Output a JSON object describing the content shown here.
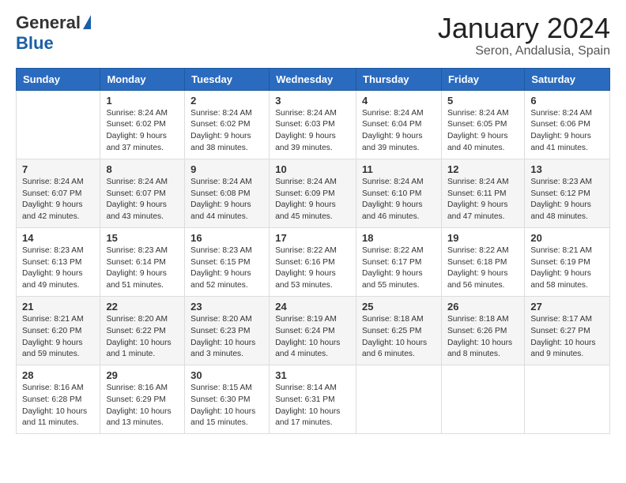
{
  "header": {
    "logo_general": "General",
    "logo_blue": "Blue",
    "title": "January 2024",
    "location": "Seron, Andalusia, Spain"
  },
  "weekdays": [
    "Sunday",
    "Monday",
    "Tuesday",
    "Wednesday",
    "Thursday",
    "Friday",
    "Saturday"
  ],
  "weeks": [
    [
      {
        "day": "",
        "sunrise": "",
        "sunset": "",
        "daylight": ""
      },
      {
        "day": "1",
        "sunrise": "Sunrise: 8:24 AM",
        "sunset": "Sunset: 6:02 PM",
        "daylight": "Daylight: 9 hours and 37 minutes."
      },
      {
        "day": "2",
        "sunrise": "Sunrise: 8:24 AM",
        "sunset": "Sunset: 6:02 PM",
        "daylight": "Daylight: 9 hours and 38 minutes."
      },
      {
        "day": "3",
        "sunrise": "Sunrise: 8:24 AM",
        "sunset": "Sunset: 6:03 PM",
        "daylight": "Daylight: 9 hours and 39 minutes."
      },
      {
        "day": "4",
        "sunrise": "Sunrise: 8:24 AM",
        "sunset": "Sunset: 6:04 PM",
        "daylight": "Daylight: 9 hours and 39 minutes."
      },
      {
        "day": "5",
        "sunrise": "Sunrise: 8:24 AM",
        "sunset": "Sunset: 6:05 PM",
        "daylight": "Daylight: 9 hours and 40 minutes."
      },
      {
        "day": "6",
        "sunrise": "Sunrise: 8:24 AM",
        "sunset": "Sunset: 6:06 PM",
        "daylight": "Daylight: 9 hours and 41 minutes."
      }
    ],
    [
      {
        "day": "7",
        "sunrise": "Sunrise: 8:24 AM",
        "sunset": "Sunset: 6:07 PM",
        "daylight": "Daylight: 9 hours and 42 minutes."
      },
      {
        "day": "8",
        "sunrise": "Sunrise: 8:24 AM",
        "sunset": "Sunset: 6:07 PM",
        "daylight": "Daylight: 9 hours and 43 minutes."
      },
      {
        "day": "9",
        "sunrise": "Sunrise: 8:24 AM",
        "sunset": "Sunset: 6:08 PM",
        "daylight": "Daylight: 9 hours and 44 minutes."
      },
      {
        "day": "10",
        "sunrise": "Sunrise: 8:24 AM",
        "sunset": "Sunset: 6:09 PM",
        "daylight": "Daylight: 9 hours and 45 minutes."
      },
      {
        "day": "11",
        "sunrise": "Sunrise: 8:24 AM",
        "sunset": "Sunset: 6:10 PM",
        "daylight": "Daylight: 9 hours and 46 minutes."
      },
      {
        "day": "12",
        "sunrise": "Sunrise: 8:24 AM",
        "sunset": "Sunset: 6:11 PM",
        "daylight": "Daylight: 9 hours and 47 minutes."
      },
      {
        "day": "13",
        "sunrise": "Sunrise: 8:23 AM",
        "sunset": "Sunset: 6:12 PM",
        "daylight": "Daylight: 9 hours and 48 minutes."
      }
    ],
    [
      {
        "day": "14",
        "sunrise": "Sunrise: 8:23 AM",
        "sunset": "Sunset: 6:13 PM",
        "daylight": "Daylight: 9 hours and 49 minutes."
      },
      {
        "day": "15",
        "sunrise": "Sunrise: 8:23 AM",
        "sunset": "Sunset: 6:14 PM",
        "daylight": "Daylight: 9 hours and 51 minutes."
      },
      {
        "day": "16",
        "sunrise": "Sunrise: 8:23 AM",
        "sunset": "Sunset: 6:15 PM",
        "daylight": "Daylight: 9 hours and 52 minutes."
      },
      {
        "day": "17",
        "sunrise": "Sunrise: 8:22 AM",
        "sunset": "Sunset: 6:16 PM",
        "daylight": "Daylight: 9 hours and 53 minutes."
      },
      {
        "day": "18",
        "sunrise": "Sunrise: 8:22 AM",
        "sunset": "Sunset: 6:17 PM",
        "daylight": "Daylight: 9 hours and 55 minutes."
      },
      {
        "day": "19",
        "sunrise": "Sunrise: 8:22 AM",
        "sunset": "Sunset: 6:18 PM",
        "daylight": "Daylight: 9 hours and 56 minutes."
      },
      {
        "day": "20",
        "sunrise": "Sunrise: 8:21 AM",
        "sunset": "Sunset: 6:19 PM",
        "daylight": "Daylight: 9 hours and 58 minutes."
      }
    ],
    [
      {
        "day": "21",
        "sunrise": "Sunrise: 8:21 AM",
        "sunset": "Sunset: 6:20 PM",
        "daylight": "Daylight: 9 hours and 59 minutes."
      },
      {
        "day": "22",
        "sunrise": "Sunrise: 8:20 AM",
        "sunset": "Sunset: 6:22 PM",
        "daylight": "Daylight: 10 hours and 1 minute."
      },
      {
        "day": "23",
        "sunrise": "Sunrise: 8:20 AM",
        "sunset": "Sunset: 6:23 PM",
        "daylight": "Daylight: 10 hours and 3 minutes."
      },
      {
        "day": "24",
        "sunrise": "Sunrise: 8:19 AM",
        "sunset": "Sunset: 6:24 PM",
        "daylight": "Daylight: 10 hours and 4 minutes."
      },
      {
        "day": "25",
        "sunrise": "Sunrise: 8:18 AM",
        "sunset": "Sunset: 6:25 PM",
        "daylight": "Daylight: 10 hours and 6 minutes."
      },
      {
        "day": "26",
        "sunrise": "Sunrise: 8:18 AM",
        "sunset": "Sunset: 6:26 PM",
        "daylight": "Daylight: 10 hours and 8 minutes."
      },
      {
        "day": "27",
        "sunrise": "Sunrise: 8:17 AM",
        "sunset": "Sunset: 6:27 PM",
        "daylight": "Daylight: 10 hours and 9 minutes."
      }
    ],
    [
      {
        "day": "28",
        "sunrise": "Sunrise: 8:16 AM",
        "sunset": "Sunset: 6:28 PM",
        "daylight": "Daylight: 10 hours and 11 minutes."
      },
      {
        "day": "29",
        "sunrise": "Sunrise: 8:16 AM",
        "sunset": "Sunset: 6:29 PM",
        "daylight": "Daylight: 10 hours and 13 minutes."
      },
      {
        "day": "30",
        "sunrise": "Sunrise: 8:15 AM",
        "sunset": "Sunset: 6:30 PM",
        "daylight": "Daylight: 10 hours and 15 minutes."
      },
      {
        "day": "31",
        "sunrise": "Sunrise: 8:14 AM",
        "sunset": "Sunset: 6:31 PM",
        "daylight": "Daylight: 10 hours and 17 minutes."
      },
      {
        "day": "",
        "sunrise": "",
        "sunset": "",
        "daylight": ""
      },
      {
        "day": "",
        "sunrise": "",
        "sunset": "",
        "daylight": ""
      },
      {
        "day": "",
        "sunrise": "",
        "sunset": "",
        "daylight": ""
      }
    ]
  ]
}
